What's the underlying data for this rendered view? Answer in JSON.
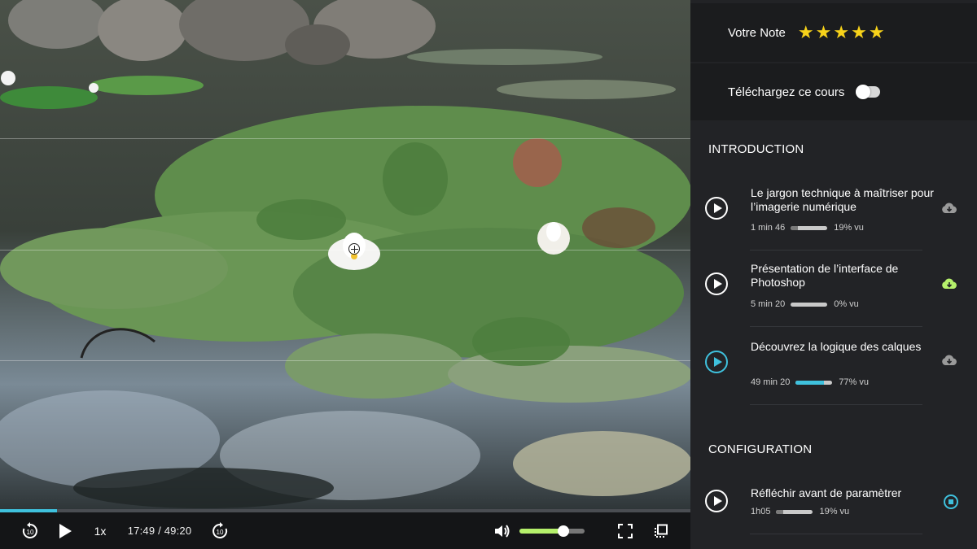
{
  "player": {
    "progress_fraction": 0.083,
    "speed_label": "1x",
    "time_label": "17:49 / 49:20",
    "volume_fraction": 0.67,
    "accent_color": "#3fc1dd",
    "volume_color": "#b5f06b"
  },
  "sidebar": {
    "rating_label": "Votre Note",
    "rating_stars": 5,
    "star_color": "#f7d21a",
    "download_label": "Téléchargez ce cours",
    "download_enabled": false,
    "sections": [
      {
        "title": "INTRODUCTION",
        "lessons": [
          {
            "title": "Le jargon technique à maîtriser pour l’imagerie numérique",
            "duration": "1 min 46",
            "watched_percent": 19,
            "watched_label": "19% vu",
            "status_icon": "cloud-download-icon",
            "status_color": "#9a9a9a",
            "active": false
          },
          {
            "title": "Présentation de l’interface de Photoshop",
            "duration": "5 min 20",
            "watched_percent": 0,
            "watched_label": "0% vu",
            "status_icon": "cloud-download-icon",
            "status_color": "#b5f06b",
            "active": false
          },
          {
            "title": "Découvrez la logique des calques",
            "duration": "49 min 20",
            "watched_percent": 77,
            "watched_label": "77% vu",
            "status_icon": "cloud-download-icon",
            "status_color": "#9a9a9a",
            "active": true
          }
        ]
      },
      {
        "title": "CONFIGURATION",
        "lessons": [
          {
            "title": "Réfléchir avant de paramètrer",
            "duration": "1h05",
            "watched_percent": 19,
            "watched_label": "19% vu",
            "status_icon": "stop-download-icon",
            "status_color": "#3fc1dd",
            "active": false
          }
        ]
      }
    ]
  }
}
